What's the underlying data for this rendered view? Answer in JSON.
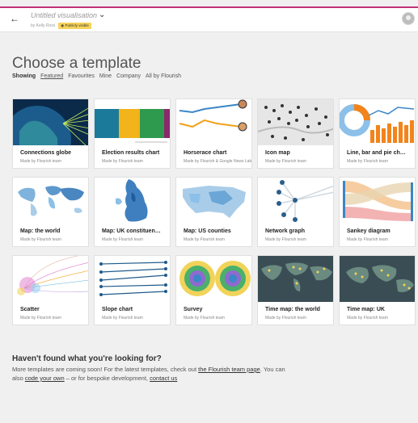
{
  "header": {
    "back_icon": "back-arrow-icon",
    "title": "Untitled visualisation",
    "byline": "by Kelly Ross",
    "visibility": "Publicly visible",
    "avatar_icon": "user-avatar-icon"
  },
  "main": {
    "heading": "Choose a template",
    "filters": {
      "label": "Showing",
      "options": [
        "Featured",
        "Favourites",
        "Mine",
        "Company",
        "All by Flourish"
      ],
      "selected": "Featured"
    },
    "templates": [
      {
        "name": "Connections globe",
        "by": "Made by Flourish team"
      },
      {
        "name": "Election results chart",
        "by": "Made by Flourish team"
      },
      {
        "name": "Horserace chart",
        "by": "Made by Flourish & Google News Lab",
        "extra": "News Lab"
      },
      {
        "name": "Icon map",
        "by": "Made by Flourish team"
      },
      {
        "name": "Line, bar and pie ch…",
        "by": "Made by Flourish team"
      },
      {
        "name": "Map: the world",
        "by": "Made by Flourish team"
      },
      {
        "name": "Map: UK constituen…",
        "by": "Made by Flourish team"
      },
      {
        "name": "Map: US counties",
        "by": "Made by Flourish team"
      },
      {
        "name": "Network graph",
        "by": "Made by Flourish team"
      },
      {
        "name": "Sankey diagram",
        "by": "Made by Flourish team"
      },
      {
        "name": "Scatter",
        "by": "Made by Flourish team"
      },
      {
        "name": "Slope chart",
        "by": "Made by Flourish team"
      },
      {
        "name": "Survey",
        "by": "Made by Flourish team"
      },
      {
        "name": "Time map: the world",
        "by": "Made by Flourish team"
      },
      {
        "name": "Time map: UK",
        "by": "Made by Flourish team"
      }
    ]
  },
  "footer": {
    "heading": "Haven't found what you're looking for?",
    "text1": "More templates are coming soon! For the latest templates, check out ",
    "link1": "the Flourish team page",
    "text2": ". You can also ",
    "link2": "code your own",
    "text3": " – or for bespoke development, ",
    "link3": "contact us"
  },
  "colors": {
    "accent": "#c2327a",
    "badge": "#f6d35a",
    "background": "#f0f0f0"
  }
}
